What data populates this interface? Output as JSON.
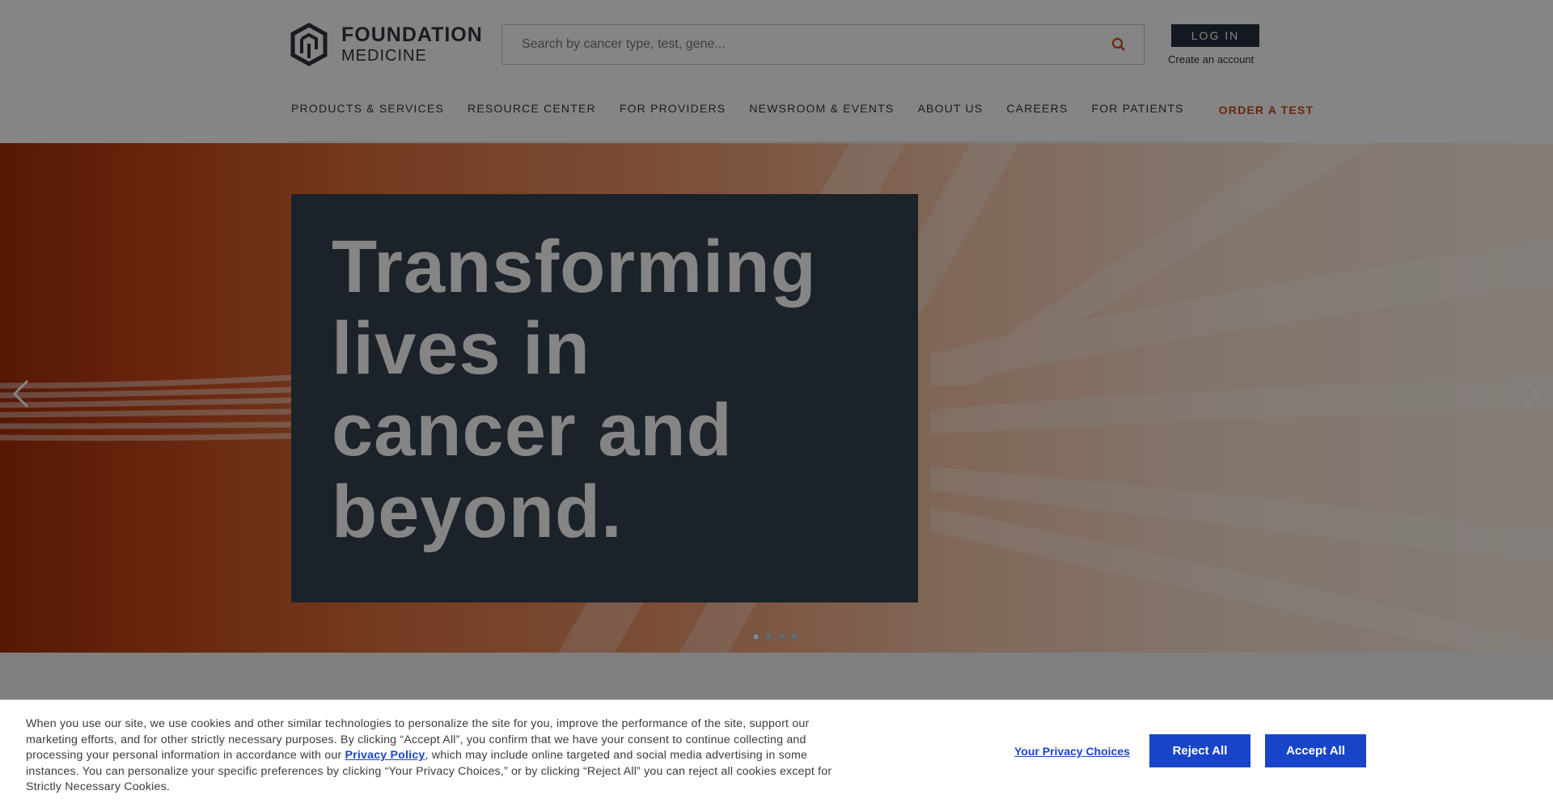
{
  "header": {
    "logo": {
      "line1": "FOUNDATION",
      "line2": "MEDICINE"
    },
    "search": {
      "placeholder": "Search by cancer type, test, gene..."
    },
    "login_label": "LOG IN",
    "create_account_label": "Create an account"
  },
  "nav": {
    "items": [
      {
        "label": "PRODUCTS & SERVICES"
      },
      {
        "label": "RESOURCE CENTER"
      },
      {
        "label": "FOR PROVIDERS"
      },
      {
        "label": "NEWSROOM & EVENTS"
      },
      {
        "label": "ABOUT US"
      },
      {
        "label": "CAREERS"
      },
      {
        "label": "FOR PATIENTS"
      }
    ],
    "order_label": "ORDER A TEST"
  },
  "hero": {
    "title_lines": [
      "Transforming",
      "lives in",
      "cancer and",
      "beyond."
    ],
    "slide_count": 4,
    "active_slide": 1
  },
  "cookie_banner": {
    "text_before_link": "When you use our site, we use cookies and other similar technologies to personalize the site for you, improve the performance of the site, support our marketing efforts, and for other strictly necessary purposes. By clicking “Accept All”, you confirm that we have your consent to continue collecting and processing your personal information in accordance with our ",
    "link_label": "Privacy Policy",
    "text_after_link": ", which may include online targeted and social media advertising in some instances. You can personalize your specific preferences by clicking “Your Privacy Choices,” or by clicking “Reject All” you can reject all cookies except for Strictly Necessary Cookies.",
    "privacy_choices_label": "Your Privacy Choices",
    "reject_label": "Reject All",
    "accept_label": "Accept All"
  },
  "colors": {
    "brand_dark": "#263040",
    "accent_orange": "#c84b1a",
    "cookie_blue": "#1845c8",
    "hero_card": "#364252"
  },
  "icons": [
    "logo-hexagon-icon",
    "search-icon",
    "chevron-left-icon",
    "chevron-right-icon"
  ]
}
